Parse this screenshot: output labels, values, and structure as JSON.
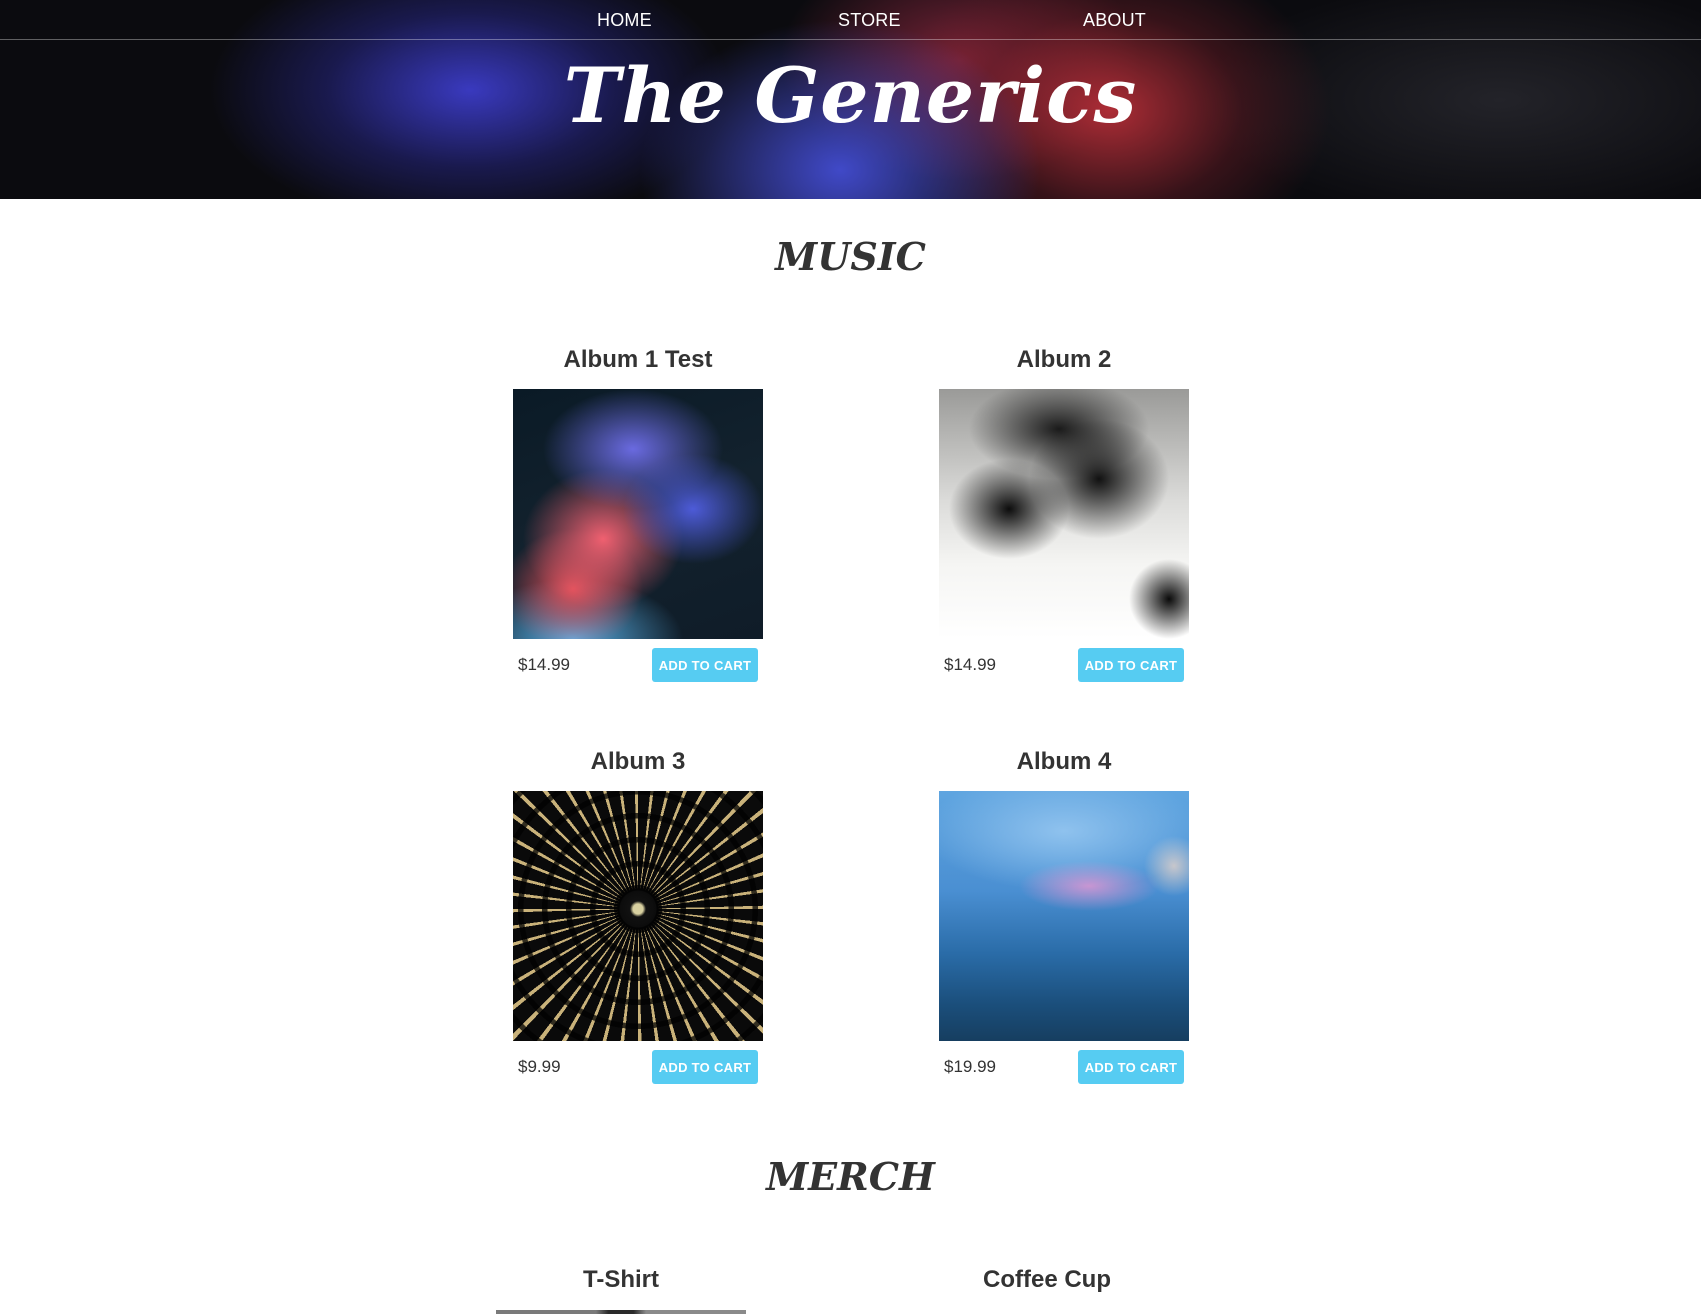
{
  "nav": {
    "home": "HOME",
    "store": "STORE",
    "about": "ABOUT"
  },
  "header": {
    "band_name": "The Generics"
  },
  "music": {
    "title": "MUSIC",
    "items": [
      {
        "title": "Album 1 Test",
        "price": "$14.99",
        "button": "ADD TO CART"
      },
      {
        "title": "Album 2",
        "price": "$14.99",
        "button": "ADD TO CART"
      },
      {
        "title": "Album 3",
        "price": "$9.99",
        "button": "ADD TO CART"
      },
      {
        "title": "Album 4",
        "price": "$19.99",
        "button": "ADD TO CART"
      }
    ]
  },
  "merch": {
    "title": "MERCH",
    "items": [
      {
        "title": "T-Shirt"
      },
      {
        "title": "Coffee Cup"
      }
    ]
  }
}
